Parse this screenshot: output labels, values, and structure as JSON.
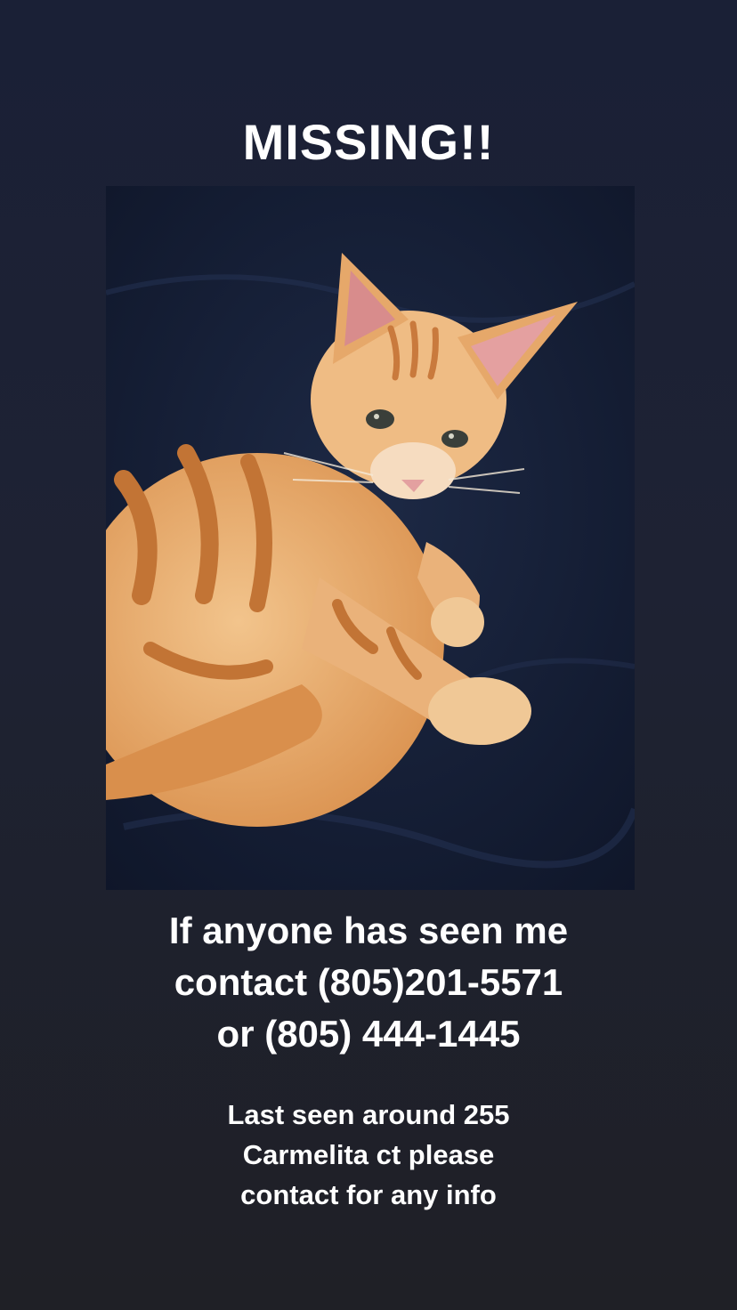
{
  "poster": {
    "title": "MISSING!!",
    "photo": {
      "icon": "kitten-photo",
      "subject_colors": {
        "fur": "#e3a060",
        "stripes": "#c97a3d",
        "blanket": "#16203a"
      }
    },
    "contact_lines": [
      "If anyone has seen me",
      "contact (805)201-5571",
      "or (805) 444-1445"
    ],
    "note_lines": [
      "Last seen around 255",
      "Carmelita ct please",
      "contact for any info"
    ]
  }
}
